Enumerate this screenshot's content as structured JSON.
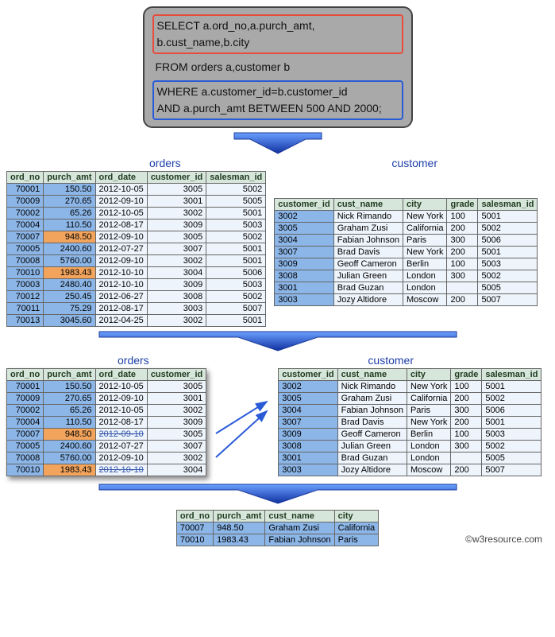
{
  "sql": {
    "line1": "SELECT  a.ord_no,a.purch_amt,",
    "line2": "b.cust_name,b.city",
    "line3": "FROM orders a,customer b",
    "line4": "WHERE a.customer_id=b.customer_id",
    "line5": "AND a.purch_amt BETWEEN 500 AND 2000;"
  },
  "labels": {
    "orders": "orders",
    "customer": "customer"
  },
  "orders_cols": [
    "ord_no",
    "purch_amt",
    "ord_date",
    "customer_id",
    "salesman_id"
  ],
  "orders_rows": [
    {
      "ord_no": "70001",
      "purch": "150.50",
      "date": "2012-10-05",
      "cust": "3005",
      "sales": "5002",
      "hl": false
    },
    {
      "ord_no": "70009",
      "purch": "270.65",
      "date": "2012-09-10",
      "cust": "3001",
      "sales": "5005",
      "hl": false
    },
    {
      "ord_no": "70002",
      "purch": "65.26",
      "date": "2012-10-05",
      "cust": "3002",
      "sales": "5001",
      "hl": false
    },
    {
      "ord_no": "70004",
      "purch": "110.50",
      "date": "2012-08-17",
      "cust": "3009",
      "sales": "5003",
      "hl": false
    },
    {
      "ord_no": "70007",
      "purch": "948.50",
      "date": "2012-09-10",
      "cust": "3005",
      "sales": "5002",
      "hl": true
    },
    {
      "ord_no": "70005",
      "purch": "2400.60",
      "date": "2012-07-27",
      "cust": "3007",
      "sales": "5001",
      "hl": false
    },
    {
      "ord_no": "70008",
      "purch": "5760.00",
      "date": "2012-09-10",
      "cust": "3002",
      "sales": "5001",
      "hl": false
    },
    {
      "ord_no": "70010",
      "purch": "1983.43",
      "date": "2012-10-10",
      "cust": "3004",
      "sales": "5006",
      "hl": true
    },
    {
      "ord_no": "70003",
      "purch": "2480.40",
      "date": "2012-10-10",
      "cust": "3009",
      "sales": "5003",
      "hl": false
    },
    {
      "ord_no": "70012",
      "purch": "250.45",
      "date": "2012-06-27",
      "cust": "3008",
      "sales": "5002",
      "hl": false
    },
    {
      "ord_no": "70011",
      "purch": "75.29",
      "date": "2012-08-17",
      "cust": "3003",
      "sales": "5007",
      "hl": false
    },
    {
      "ord_no": "70013",
      "purch": "3045.60",
      "date": "2012-04-25",
      "cust": "3002",
      "sales": "5001",
      "hl": false
    }
  ],
  "customer_cols": [
    "customer_id",
    "cust_name",
    "city",
    "grade",
    "salesman_id"
  ],
  "customer_rows": [
    {
      "id": "3002",
      "name": "Nick Rimando",
      "city": "New York",
      "grade": "100",
      "sales": "5001"
    },
    {
      "id": "3005",
      "name": "Graham Zusi",
      "city": "California",
      "grade": "200",
      "sales": "5002"
    },
    {
      "id": "3004",
      "name": "Fabian Johnson",
      "city": "Paris",
      "grade": "300",
      "sales": "5006"
    },
    {
      "id": "3007",
      "name": "Brad Davis",
      "city": "New York",
      "grade": "200",
      "sales": "5001"
    },
    {
      "id": "3009",
      "name": "Geoff Cameron",
      "city": "Berlin",
      "grade": "100",
      "sales": "5003"
    },
    {
      "id": "3008",
      "name": "Julian Green",
      "city": "London",
      "grade": "300",
      "sales": "5002"
    },
    {
      "id": "3001",
      "name": "Brad Guzan",
      "city": "London",
      "grade": "",
      "sales": "5005"
    },
    {
      "id": "3003",
      "name": "Jozy Altidore",
      "city": "Moscow",
      "grade": "200",
      "sales": "5007"
    }
  ],
  "orders2_cols": [
    "ord_no",
    "purch_amt",
    "ord_date",
    "customer_id"
  ],
  "orders2_rows": [
    {
      "ord_no": "70001",
      "purch": "150.50",
      "date": "2012-10-05",
      "cust": "3005",
      "hl": false,
      "strike": false
    },
    {
      "ord_no": "70009",
      "purch": "270.65",
      "date": "2012-09-10",
      "cust": "3001",
      "hl": false,
      "strike": false
    },
    {
      "ord_no": "70002",
      "purch": "65.26",
      "date": "2012-10-05",
      "cust": "3002",
      "hl": false,
      "strike": false
    },
    {
      "ord_no": "70004",
      "purch": "110.50",
      "date": "2012-08-17",
      "cust": "3009",
      "hl": false,
      "strike": false
    },
    {
      "ord_no": "70007",
      "purch": "948.50",
      "date": "2012-09-10",
      "cust": "3005",
      "hl": true,
      "strike": true
    },
    {
      "ord_no": "70005",
      "purch": "2400.60",
      "date": "2012-07-27",
      "cust": "3007",
      "hl": false,
      "strike": false
    },
    {
      "ord_no": "70008",
      "purch": "5760.00",
      "date": "2012-09-10",
      "cust": "3002",
      "hl": false,
      "strike": false
    },
    {
      "ord_no": "70010",
      "purch": "1983.43",
      "date": "2012-10-10",
      "cust": "3004",
      "hl": true,
      "strike": true
    }
  ],
  "result_cols": [
    "ord_no",
    "purch_amt",
    "cust_name",
    "city"
  ],
  "result_rows": [
    {
      "ord_no": "70007",
      "purch": "948.50",
      "name": "Graham Zusi",
      "city": "California"
    },
    {
      "ord_no": "70010",
      "purch": "1983.43",
      "name": "Fabian Johnson",
      "city": "Paris"
    }
  ],
  "footer": "©w3resource.com"
}
